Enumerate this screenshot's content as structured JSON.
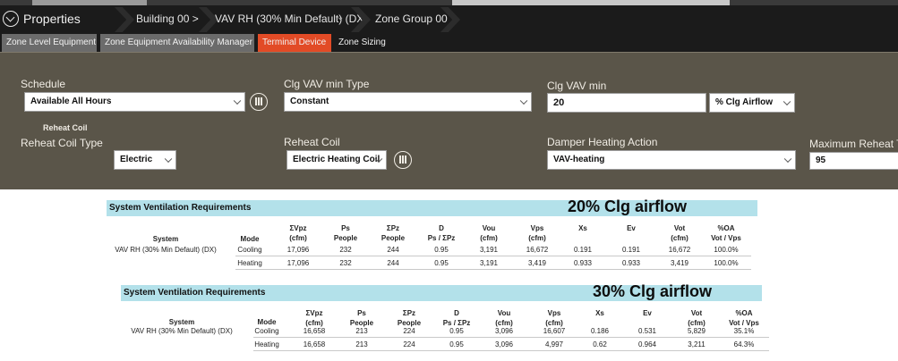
{
  "header": {
    "title": "Properties",
    "breadcrumbs": [
      "Building 00 >",
      "VAV RH (30% Min Default) (DX)",
      "Zone Group 00"
    ]
  },
  "tabs": [
    "Zone Level Equipment",
    "Zone Equipment Availability Manager",
    "Terminal Device",
    "Zone Sizing"
  ],
  "active_tab": "Terminal Device",
  "form": {
    "schedule_label": "Schedule",
    "schedule_value": "Available All Hours",
    "clg_vav_min_type_label": "Clg VAV min Type",
    "clg_vav_min_type_value": "Constant",
    "clg_vav_min_label": "Clg VAV min",
    "clg_vav_min_value": "20",
    "clg_vav_min_unit": "% Clg Airflow",
    "reheat_section": "Reheat Coil",
    "reheat_coil_type_label": "Reheat Coil Type",
    "reheat_coil_type_value": "Electric",
    "reheat_coil_label": "Reheat Coil",
    "reheat_coil_value": "Electric Heating Coil",
    "damper_label": "Damper Heating Action",
    "damper_value": "VAV-heating",
    "max_reheat_label": "Maximum Reheat T",
    "max_reheat_value": "95"
  },
  "reports": [
    {
      "title": "System Ventilation Requirements",
      "annotation": "20% Clg airflow",
      "headers": [
        [
          "System",
          ""
        ],
        [
          "Mode",
          ""
        ],
        [
          "ΣVpz",
          "(cfm)"
        ],
        [
          "Ps",
          "People"
        ],
        [
          "ΣPz",
          "People"
        ],
        [
          "D",
          "Ps / ΣPz"
        ],
        [
          "Vou",
          "(cfm)"
        ],
        [
          "Vps",
          "(cfm)"
        ],
        [
          "Xs",
          ""
        ],
        [
          "Ev",
          ""
        ],
        [
          "Vot",
          "(cfm)"
        ],
        [
          "%OA",
          "Vot / Vps"
        ]
      ],
      "system": "VAV RH (30% Min Default) (DX)",
      "rows": [
        [
          "Cooling",
          "17,096",
          "232",
          "244",
          "0.95",
          "3,191",
          "16,672",
          "0.191",
          "0.191",
          "16,672",
          "100.0%"
        ],
        [
          "Heating",
          "17,096",
          "232",
          "244",
          "0.95",
          "3,191",
          "3,419",
          "0.933",
          "0.933",
          "3,419",
          "100.0%"
        ]
      ]
    },
    {
      "title": "System Ventilation Requirements",
      "annotation": "30% Clg airflow",
      "headers": [
        [
          "System",
          ""
        ],
        [
          "Mode",
          ""
        ],
        [
          "ΣVpz",
          "(cfm)"
        ],
        [
          "Ps",
          "People"
        ],
        [
          "ΣPz",
          "People"
        ],
        [
          "D",
          "Ps / ΣPz"
        ],
        [
          "Vou",
          "(cfm)"
        ],
        [
          "Vps",
          "(cfm)"
        ],
        [
          "Xs",
          ""
        ],
        [
          "Ev",
          ""
        ],
        [
          "Vot",
          "(cfm)"
        ],
        [
          "%OA",
          "Vot / Vps"
        ]
      ],
      "system": "VAV RH (30% Min Default) (DX)",
      "rows": [
        [
          "Cooling",
          "16,658",
          "213",
          "224",
          "0.95",
          "3,096",
          "16,607",
          "0.186",
          "0.531",
          "5,829",
          "35.1%"
        ],
        [
          "Heating",
          "16,658",
          "213",
          "224",
          "0.95",
          "3,096",
          "4,997",
          "0.62",
          "0.964",
          "3,211",
          "64.3%"
        ]
      ]
    }
  ]
}
